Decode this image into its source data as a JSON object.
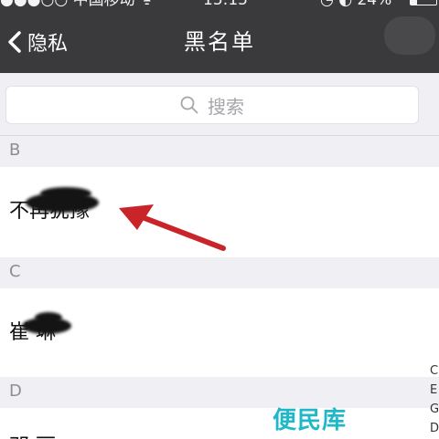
{
  "status_bar": {
    "carrier": "●●●○○ 中国移动 ᯤ",
    "time": "15:15",
    "battery": "◷ ◐ 24%",
    "battery_level": 0.24
  },
  "nav": {
    "back_label": "隐私",
    "title": "黑名单"
  },
  "search": {
    "placeholder": "搜索"
  },
  "sections": [
    {
      "header": "B",
      "contact": "不再犹豫"
    },
    {
      "header": "C",
      "contact": "崔  琳"
    },
    {
      "header": "D",
      "contact": "邓  丽"
    }
  ],
  "index_bar": [
    "C",
    "E",
    "G",
    "D"
  ],
  "watermark": "便民库",
  "colors": {
    "navbar": "#3a3a3c",
    "section_bg": "#efeff4",
    "arrow": "#c9242a",
    "watermark": "#1fb8c9"
  }
}
